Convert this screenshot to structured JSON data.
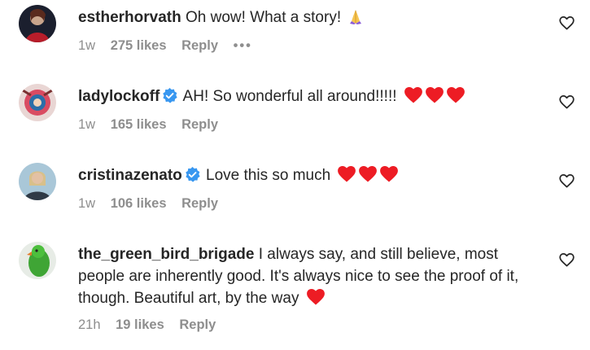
{
  "comments": [
    {
      "username": "estherhorvath",
      "verified": false,
      "text": "Oh wow! What a story!",
      "emoji": "praying-hands",
      "age": "1w",
      "likes": "275 likes",
      "reply": "Reply",
      "more": "•••"
    },
    {
      "username": "ladylockoff",
      "verified": true,
      "text": "AH! So wonderful all around!!!!!",
      "emoji": "three-red-hearts",
      "age": "1w",
      "likes": "165 likes",
      "reply": "Reply"
    },
    {
      "username": "cristinazenato",
      "verified": true,
      "text": "Love this so much",
      "emoji": "three-red-hearts",
      "age": "1w",
      "likes": "106 likes",
      "reply": "Reply"
    },
    {
      "username": "the_green_bird_brigade",
      "verified": false,
      "text": "I always say, and still believe, most people are inherently good. It's always nice to see the proof of it, though. Beautiful art, by the way",
      "emoji": "red-heart",
      "age": "21h",
      "likes": "19 likes",
      "reply": "Reply"
    }
  ],
  "colors": {
    "verified_blue": "#3897f0",
    "heart_red": "#ed1c24",
    "meta_gray": "#8e8e8e"
  }
}
